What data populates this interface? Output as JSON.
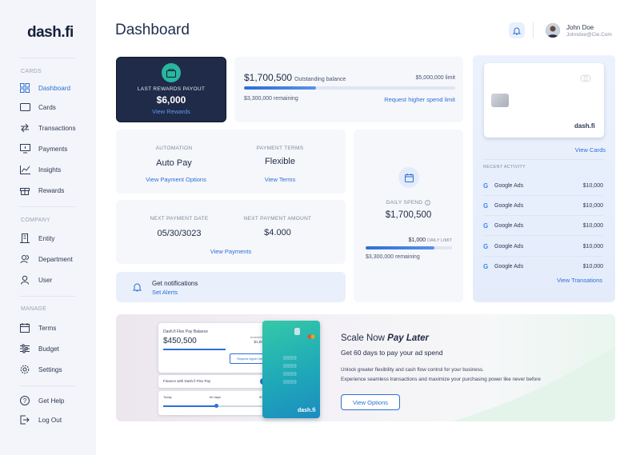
{
  "app": {
    "logo": "dash.fi"
  },
  "sidebar": {
    "cards_section": "CARDS",
    "company_section": "COMPANY",
    "manage_section": "MANAGE",
    "items": [
      {
        "label": "Dashboard",
        "icon": "grid-icon"
      },
      {
        "label": "Cards",
        "icon": "card-icon"
      },
      {
        "label": "Transactions",
        "icon": "arrows-icon"
      },
      {
        "label": "Payments",
        "icon": "payment-icon"
      },
      {
        "label": "Insights",
        "icon": "chart-icon"
      },
      {
        "label": "Rewards",
        "icon": "gift-icon"
      },
      {
        "label": "Entity",
        "icon": "building-icon"
      },
      {
        "label": "Department",
        "icon": "team-icon"
      },
      {
        "label": "User",
        "icon": "user-icon"
      },
      {
        "label": "Terms",
        "icon": "calendar-icon"
      },
      {
        "label": "Budget",
        "icon": "sliders-icon"
      },
      {
        "label": "Settings",
        "icon": "gear-icon"
      },
      {
        "label": "Get Help",
        "icon": "help-icon"
      },
      {
        "label": "Log Out",
        "icon": "logout-icon"
      }
    ]
  },
  "header": {
    "title": "Dashboard",
    "user_name": "John Doe",
    "user_email": "Johndoe@Cie.Com"
  },
  "rewards": {
    "label": "LAST REWARDS PAYOUT",
    "amount": "$6,000",
    "link": "View Rewards"
  },
  "balance": {
    "amount": "$1,700,500",
    "amount_label": "Outstanding balance",
    "limit": "$5,000,000 limit",
    "remaining": "$3,300,000 remaining",
    "link": "Request higher spend limit",
    "progress": 0.34
  },
  "automation": {
    "label": "AUTOMATION",
    "value": "Auto Pay",
    "link": "View Payment Options"
  },
  "terms": {
    "label": "PAYMENT TERMS",
    "value": "Flexible",
    "link": "View Terms"
  },
  "next_payment": {
    "date_label": "NEXT PAYMENT DATE",
    "date": "05/30/3023",
    "amount_label": "NEXT PAYMENT AMOUNT",
    "amount": "$4.000",
    "link": "View Payments"
  },
  "notifications": {
    "title": "Get notifications",
    "link": "Set Alerts"
  },
  "daily_spend": {
    "label": "DAILY SPEND",
    "amount": "$1,700,500",
    "limit_value": "$1,000",
    "limit_label": "DAILY LIMIT",
    "remaining": "$3,300,000 remaining",
    "progress": 0.8
  },
  "card_panel": {
    "card_brand": "dash.fi",
    "view_cards": "View Cards",
    "recent_label": "RECENT ACTIVITY",
    "activity": [
      {
        "merchant": "Google Ads",
        "amount": "$10,000"
      },
      {
        "merchant": "Google Ads",
        "amount": "$10,000"
      },
      {
        "merchant": "Google Ads",
        "amount": "$10,000"
      },
      {
        "merchant": "Google Ads",
        "amount": "$10,000"
      },
      {
        "merchant": "Google Ads",
        "amount": "$10,000"
      }
    ],
    "view_transactions": "View Transations"
  },
  "promo": {
    "title_plain": "Scale Now ",
    "title_emph": "Pay Later",
    "subtitle": "Get 60 days to pay your ad spend",
    "body1": "Unlock greater flexibility and cash flow control for your business.",
    "body2": "Experience seamless transactions and maximize your purchasing power like never before",
    "button": "View Options",
    "mock": {
      "balance_label": "Dash.fi Flex Pay Balance",
      "balance": "$450,500",
      "available": "Available to Pay",
      "available_amount": "$1,000,000",
      "request": "Request higher limit",
      "toggle_label": "Finance with Dash.fi Flex Pay",
      "today": "Today",
      "d60": "60 days",
      "d90": "90 days",
      "card_brand": "dash.fi"
    }
  }
}
